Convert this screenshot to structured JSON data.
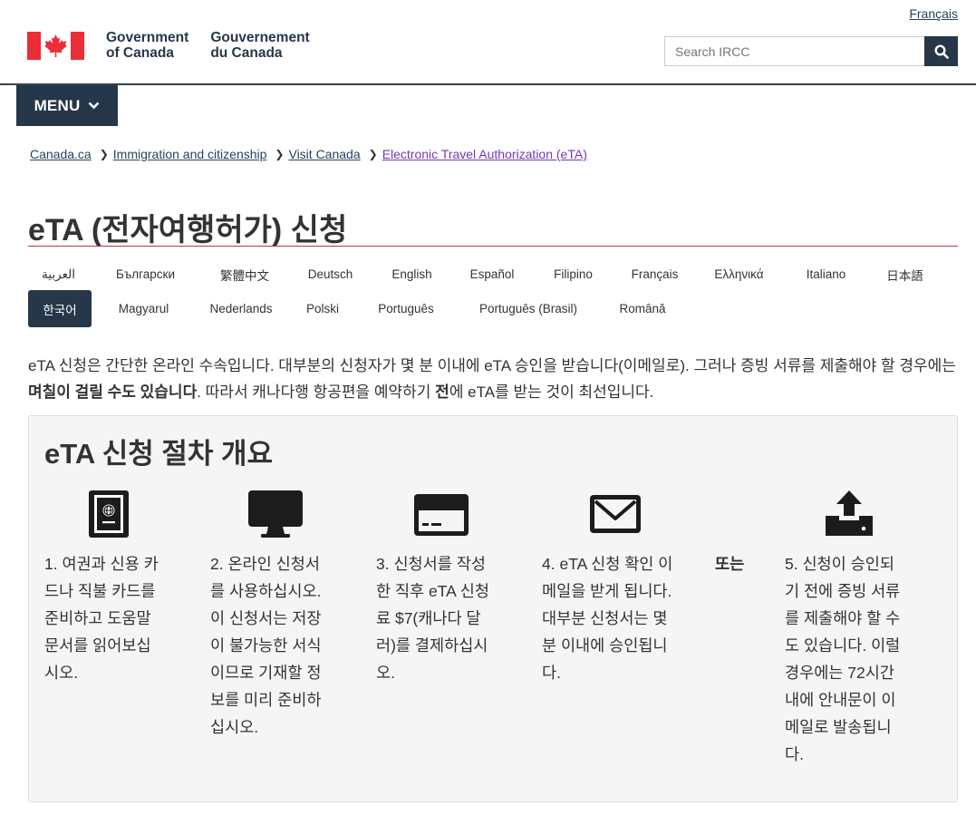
{
  "header": {
    "lang_toggle": "Français",
    "signature_en": "Government\nof Canada",
    "signature_fr": "Gouvernement\ndu Canada",
    "search_placeholder": "Search IRCC",
    "menu_label": "MENU"
  },
  "breadcrumb": [
    {
      "label": "Canada.ca"
    },
    {
      "label": "Immigration and citizenship"
    },
    {
      "label": "Visit Canada"
    },
    {
      "label": "Electronic Travel Authorization (eTA)"
    }
  ],
  "page_title": "eTA (전자여행허가) 신청",
  "languages": {
    "row1": [
      "العربية",
      "Български",
      "繁體中文",
      "Deutsch",
      "English",
      "Español",
      "Filipino",
      "Français",
      "Ελληνικά",
      "Italiano",
      "日本語"
    ],
    "row2": [
      "한국어",
      "Magyarul",
      "Nederlands",
      "Polski",
      "Português",
      "Português (Brasil)",
      "Română"
    ],
    "active": "한국어"
  },
  "intro": {
    "part1": "eTA 신청은 간단한 온라인 수속입니다. 대부분의 신청자가 몇 분 이내에 eTA 승인을 받습니다(이메일로). 그러나 증빙 서류를 제출해야 할 경우에는 ",
    "bold1": "며칠이 걸릴 수도 있습니다",
    "part2": ". 따라서 캐나다행 항공편을 예약하기 ",
    "bold2": "전",
    "part3": "에 eTA를 받는 것이 최선입니다."
  },
  "panel": {
    "title": "eTA 신청 절차 개요",
    "or_label": "또는",
    "steps": [
      {
        "icon": "passport-icon",
        "text": "1. 여권과 신용 카\n드나 직불 카드를\n준비하고 도움말\n문서를 읽어보십\n시오."
      },
      {
        "icon": "computer-monitor-icon",
        "text": "2. 온라인 신청서\n를 사용하십시오.\n이 신청서는 저장\n이 불가능한 서식\n이므로 기재할 정\n보를 미리 준비하\n십시오."
      },
      {
        "icon": "credit-card-icon",
        "text": "3. 신청서를 작성\n한 직후 eTA 신청\n료 $7(캐나다 달\n러)를 결제하십시\n오."
      },
      {
        "icon": "envelope-icon",
        "text": "4. eTA 신청 확인 이\n메일을 받게 됩니다.\n대부분 신청서는 몇\n분 이내에 승인됩니\n다."
      },
      {
        "icon": "upload-icon",
        "text": "5. 신청이 승인되\n기 전에 증빙 서류\n를 제출해야 할 수\n도 있습니다. 이럴\n경우에는 72시간\n내에 안내문이 이\n메일로 발송됩니\n다."
      }
    ]
  }
}
